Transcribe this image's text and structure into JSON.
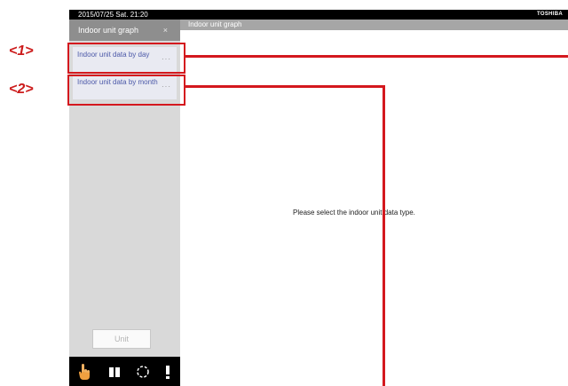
{
  "status_bar": {
    "datetime": "2015/07/25  Sat.  21:20",
    "brand": "TOSHIBA"
  },
  "sidebar": {
    "tab_label": "Indoor unit graph",
    "tab_close": "×",
    "items": [
      {
        "label": "Indoor unit data by day",
        "more": "···"
      },
      {
        "label": "Indoor unit data by month",
        "more": "···"
      }
    ],
    "unit_button": "Unit"
  },
  "bottom_bar": {
    "icons": [
      "hand-pointer-icon",
      "pause-icon",
      "refresh-icon",
      "alert-icon"
    ]
  },
  "main": {
    "header_title": "Indoor unit graph",
    "message": "Please select the indoor unit data type."
  },
  "annotations": {
    "callout_1": "<1>",
    "callout_2": "<2>",
    "accent_color": "#d4181e"
  }
}
